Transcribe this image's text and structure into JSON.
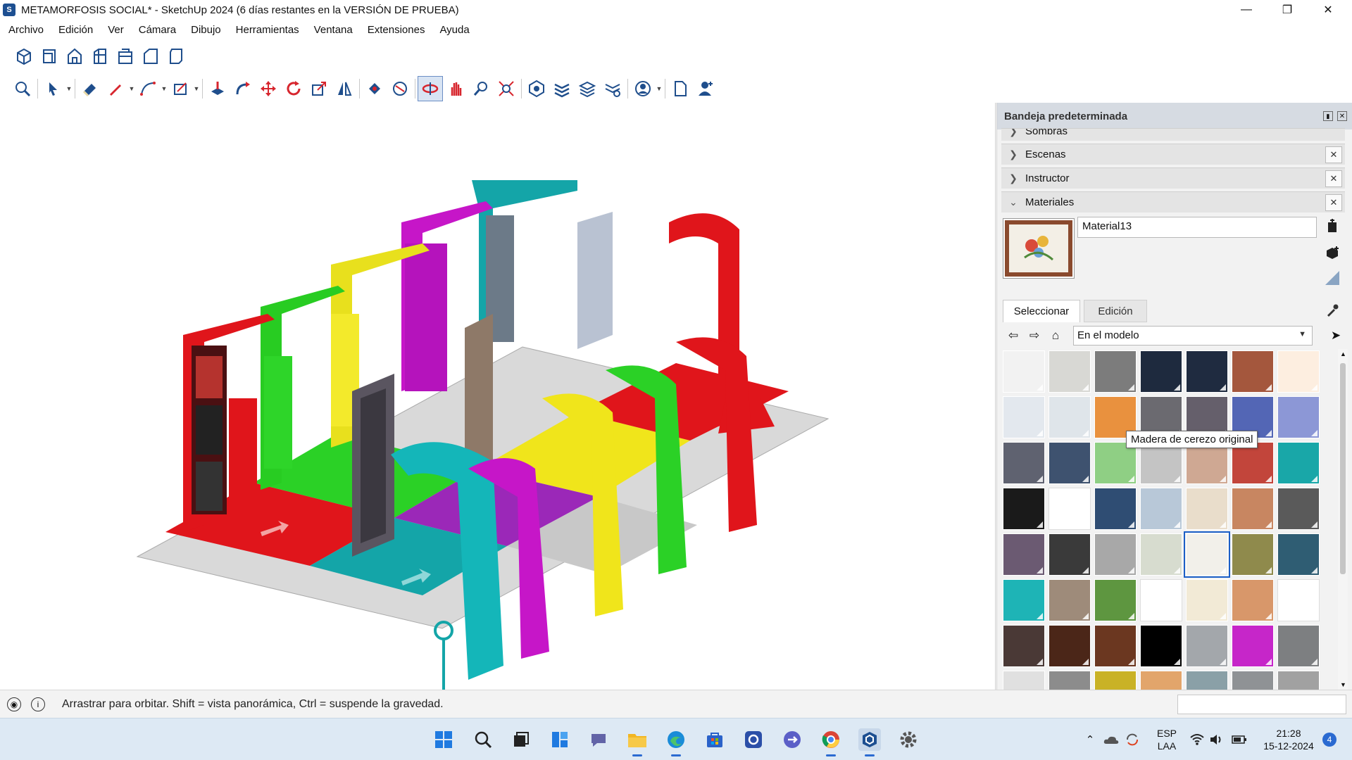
{
  "window": {
    "title": "METAMORFOSIS SOCIAL* - SketchUp 2024 (6 días restantes en la VERSIÓN DE PRUEBA)",
    "controls": [
      "minimize",
      "restore",
      "close"
    ]
  },
  "menu": [
    "Archivo",
    "Edición",
    "Ver",
    "Cámara",
    "Dibujo",
    "Herramientas",
    "Ventana",
    "Extensiones",
    "Ayuda"
  ],
  "toolbar_views": [
    "iso-view-icon",
    "top-view-icon",
    "front-view-icon",
    "right-view-icon",
    "back-view-icon",
    "left-view-icon",
    "bottom-view-icon"
  ],
  "toolbar_main": [
    "zoom-icon",
    "select-icon",
    "eraser-icon",
    "pencil-line-icon",
    "arc-icon",
    "rectangle-icon",
    "push-pull-icon",
    "follow-me-icon",
    "move-icon",
    "rotate-icon",
    "scale-icon",
    "flip-icon",
    "paint-bucket-icon",
    "orbit-section-icon",
    "orbit-icon",
    "pan-icon",
    "zoom-window-icon",
    "zoom-extents-icon",
    "warehouse-icon",
    "layers-icon",
    "layers-manager-icon",
    "settings-icon",
    "user-account-icon",
    "new-document-icon",
    "person-icon"
  ],
  "tray": {
    "title": "Bandeja predeterminada",
    "panels": [
      {
        "label": "Sombras",
        "state": "collapsed"
      },
      {
        "label": "Escenas",
        "state": "collapsed"
      },
      {
        "label": "Instructor",
        "state": "collapsed"
      },
      {
        "label": "Materiales",
        "state": "expanded"
      }
    ],
    "materials": {
      "name": "Material13",
      "tabs": [
        "Seleccionar",
        "Edición"
      ],
      "active_tab": "Seleccionar",
      "library": "En el modelo",
      "tooltip": "Madera de cerezo original",
      "swatches": [
        "#f2f2f2",
        "#d8d8d4",
        "#7c7c7c",
        "#1e2a3e",
        "#1f2b40",
        "#a4573d",
        "#fdeee0",
        "#e3e8ee",
        "#dfe5ea",
        "#e9913e",
        "#6b6a70",
        "#655f6b",
        "#5366b5",
        "#8c97d6",
        "#5f6270",
        "#3e526f",
        "#8fcf84",
        "#c4c4c4",
        "#cfa893",
        "#c2453b",
        "#19a7a8",
        "#1a1a1a",
        "#ffffff",
        "#2f4d73",
        "#b8c8d8",
        "#e9ddcb",
        "#c88661",
        "#5a5a5a",
        "#6b5a72",
        "#3a3a3a",
        "#a8a8a8",
        "#d7dccf",
        "#f2f0ea",
        "#8f8a4c",
        "#2f5d73",
        "#1eb4b6",
        "#9e8b7a",
        "#5e9640",
        "#ffffff",
        "#f2ead6",
        "#d8976a",
        "#ffffff",
        "#4a3936",
        "#4b2618",
        "#6b3720",
        "#000000",
        "#a3a7ab",
        "#c626c9",
        "#7d7f81",
        "#e0e0e0",
        "#8c8c8c",
        "#c9b226",
        "#e2a56b",
        "#8aa0a7",
        "#8f9295",
        "#a1a1a1"
      ],
      "selected_index": 32
    }
  },
  "status": {
    "message": "Arrastrar para orbitar. Shift = vista panorámica, Ctrl = suspende la gravedad."
  },
  "taskbar": {
    "apps": [
      "windows-start-icon",
      "search-icon",
      "task-view-icon",
      "widgets-icon",
      "teams-chat-icon",
      "file-explorer-icon",
      "edge-icon",
      "store-icon",
      "quickassist-icon",
      "remote-icon",
      "chrome-icon",
      "sketchup-icon",
      "settings-icon"
    ],
    "lang": "ESP",
    "layout": "LAA",
    "time": "21:28",
    "date": "15-12-2024",
    "notifications": "4"
  }
}
